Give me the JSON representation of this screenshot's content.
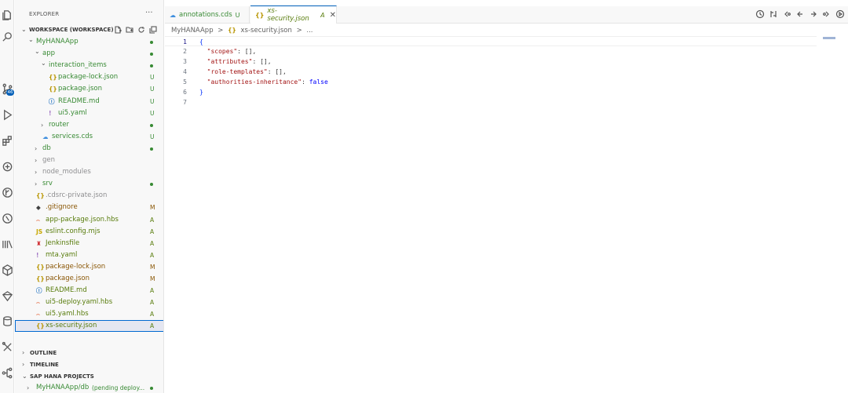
{
  "colors": {
    "accent": "#005fb8",
    "untracked_green": "#388a34",
    "modified_amber": "#895503",
    "added_green": "#587c0c",
    "muted_gray": "#8e8e90",
    "json_icon": "#b89500",
    "yaml_icon": "#a074c4",
    "info_icon": "#1f70c1",
    "hbs_icon": "#e2653c",
    "js_icon": "#c8a800",
    "jenkins_icon": "#d13438",
    "git_icon": "#404040",
    "cloud_icon": "#3e8ede",
    "selection_bg": "#e4e6f1"
  },
  "activity_bar": {
    "items": [
      {
        "name": "explorer-icon"
      },
      {
        "name": "search-icon"
      },
      {
        "name": "source-control-icon",
        "badge": "46"
      },
      {
        "name": "run-debug-icon"
      },
      {
        "name": "extensions-icon"
      },
      {
        "name": "cloud-foundry-icon"
      },
      {
        "name": "git-graph-icon"
      },
      {
        "name": "test-icon"
      },
      {
        "name": "library-icon"
      },
      {
        "name": "package-icon"
      },
      {
        "name": "gem-icon"
      },
      {
        "name": "database-icon"
      },
      {
        "name": "tools-icon"
      },
      {
        "name": "hierarchy-icon"
      }
    ]
  },
  "sidebar": {
    "title": "EXPLORER",
    "more": "···",
    "workspace_label": "WORKSPACE (WORKSPACE)",
    "tree": [
      {
        "label": "MyHANAApp",
        "indent": 1,
        "chev": "⌄",
        "status": "dot",
        "tone": "untracked_green"
      },
      {
        "label": "app",
        "indent": 2,
        "chev": "⌄",
        "status": "dot",
        "tone": "untracked_green"
      },
      {
        "label": "interaction_items",
        "indent": 3,
        "chev": "⌄",
        "status": "dot",
        "tone": "untracked_green"
      },
      {
        "label": "package-lock.json",
        "indent": 4,
        "icon": "{}",
        "icon_tone": "json_icon",
        "status": "U",
        "tone": "untracked_green"
      },
      {
        "label": "package.json",
        "indent": 4,
        "icon": "{}",
        "icon_tone": "json_icon",
        "status": "U",
        "tone": "untracked_green"
      },
      {
        "label": "README.md",
        "indent": 4,
        "icon": "ⓘ",
        "icon_tone": "info_icon",
        "status": "U",
        "tone": "untracked_green"
      },
      {
        "label": "ui5.yaml",
        "indent": 4,
        "icon": "!",
        "icon_tone": "yaml_icon",
        "status": "U",
        "tone": "untracked_green"
      },
      {
        "label": "router",
        "indent": 3,
        "chev": "›",
        "status": "dot",
        "tone": "untracked_green"
      },
      {
        "label": "services.cds",
        "indent": 3,
        "icon": "☁",
        "icon_tone": "cloud_icon",
        "status": "U",
        "tone": "untracked_green"
      },
      {
        "label": "db",
        "indent": 2,
        "chev": "›",
        "status": "dot",
        "tone": "untracked_green"
      },
      {
        "label": "gen",
        "indent": 2,
        "chev": "›",
        "status": "",
        "tone": "muted_gray"
      },
      {
        "label": "node_modules",
        "indent": 2,
        "chev": "›",
        "status": "",
        "tone": "muted_gray"
      },
      {
        "label": "srv",
        "indent": 2,
        "chev": "›",
        "status": "dot",
        "tone": "untracked_green"
      },
      {
        "label": ".cdsrc-private.json",
        "indent": 2,
        "icon": "{}",
        "icon_tone": "json_icon",
        "status": "",
        "tone": "muted_gray"
      },
      {
        "label": ".gitignore",
        "indent": 2,
        "icon": "◆",
        "icon_tone": "git_icon",
        "status": "M",
        "tone": "modified_amber"
      },
      {
        "label": "app-package.json.hbs",
        "indent": 2,
        "icon": "⌢",
        "icon_tone": "hbs_icon",
        "status": "A",
        "tone": "added_green"
      },
      {
        "label": "eslint.config.mjs",
        "indent": 2,
        "icon": "JS",
        "icon_tone": "js_icon",
        "status": "A",
        "tone": "added_green"
      },
      {
        "label": "Jenkinsfile",
        "indent": 2,
        "icon": "♜",
        "icon_tone": "jenkins_icon",
        "status": "A",
        "tone": "added_green"
      },
      {
        "label": "mta.yaml",
        "indent": 2,
        "icon": "!",
        "icon_tone": "yaml_icon",
        "status": "A",
        "tone": "added_green"
      },
      {
        "label": "package-lock.json",
        "indent": 2,
        "icon": "{}",
        "icon_tone": "json_icon",
        "status": "M",
        "tone": "modified_amber"
      },
      {
        "label": "package.json",
        "indent": 2,
        "icon": "{}",
        "icon_tone": "json_icon",
        "status": "M",
        "tone": "modified_amber"
      },
      {
        "label": "README.md",
        "indent": 2,
        "icon": "ⓘ",
        "icon_tone": "info_icon",
        "status": "A",
        "tone": "added_green"
      },
      {
        "label": "ui5-deploy.yaml.hbs",
        "indent": 2,
        "icon": "⌢",
        "icon_tone": "hbs_icon",
        "status": "A",
        "tone": "added_green"
      },
      {
        "label": "ui5.yaml.hbs",
        "indent": 2,
        "icon": "⌢",
        "icon_tone": "hbs_icon",
        "status": "A",
        "tone": "added_green"
      },
      {
        "label": "xs-security.json",
        "indent": 2,
        "icon": "{}",
        "icon_tone": "json_icon",
        "status": "A",
        "tone": "added_green",
        "selected": true
      }
    ],
    "sections": [
      {
        "label": "OUTLINE",
        "chev": "›"
      },
      {
        "label": "TIMELINE",
        "chev": "›"
      },
      {
        "label": "SAP HANA PROJECTS",
        "chev": "⌄"
      }
    ],
    "hana_project": {
      "label": "MyHANAApp/db",
      "detail": "(pending deploy...",
      "tone": "untracked_green"
    }
  },
  "tabs": [
    {
      "icon": "☁",
      "icon_tone": "cloud_icon",
      "label": "annotations.cds",
      "status": "U",
      "tone": "untracked_green",
      "active": false
    },
    {
      "icon": "{}",
      "icon_tone": "json_icon",
      "label": "xs-security.json",
      "status": "A",
      "tone": "added_green",
      "active": true,
      "close": "✕"
    }
  ],
  "editor_actions": [
    {
      "name": "timeline-icon"
    },
    {
      "name": "compare-icon"
    },
    {
      "name": "go-back-icon"
    },
    {
      "name": "previous-change-icon"
    },
    {
      "name": "next-change-icon"
    },
    {
      "name": "go-forward-icon"
    },
    {
      "name": "preview-icon"
    },
    {
      "name": "split-editor-icon"
    },
    {
      "name": "more-actions-icon"
    }
  ],
  "breadcrumb": {
    "root": "MyHANAApp",
    "sep": ">",
    "file_icon": "{}",
    "file": "xs-security.json",
    "ellipsis": "..."
  },
  "code": {
    "lines": [
      {
        "n": "1",
        "current": true,
        "parts": [
          {
            "t": "{",
            "c": "br"
          }
        ]
      },
      {
        "n": "2",
        "parts": [
          {
            "t": "  ",
            "c": ""
          },
          {
            "t": "\"scopes\"",
            "c": "k"
          },
          {
            "t": ": [],",
            "c": ""
          }
        ]
      },
      {
        "n": "3",
        "parts": [
          {
            "t": "  ",
            "c": ""
          },
          {
            "t": "\"attributes\"",
            "c": "k"
          },
          {
            "t": ": [],",
            "c": ""
          }
        ]
      },
      {
        "n": "4",
        "parts": [
          {
            "t": "  ",
            "c": ""
          },
          {
            "t": "\"role-templates\"",
            "c": "k"
          },
          {
            "t": ": [],",
            "c": ""
          }
        ]
      },
      {
        "n": "5",
        "parts": [
          {
            "t": "  ",
            "c": ""
          },
          {
            "t": "\"authorities-inheritance\"",
            "c": "k"
          },
          {
            "t": ": ",
            "c": ""
          },
          {
            "t": "false",
            "c": "kw"
          }
        ]
      },
      {
        "n": "6",
        "parts": [
          {
            "t": "}",
            "c": "br"
          }
        ]
      },
      {
        "n": "7",
        "parts": []
      }
    ]
  }
}
